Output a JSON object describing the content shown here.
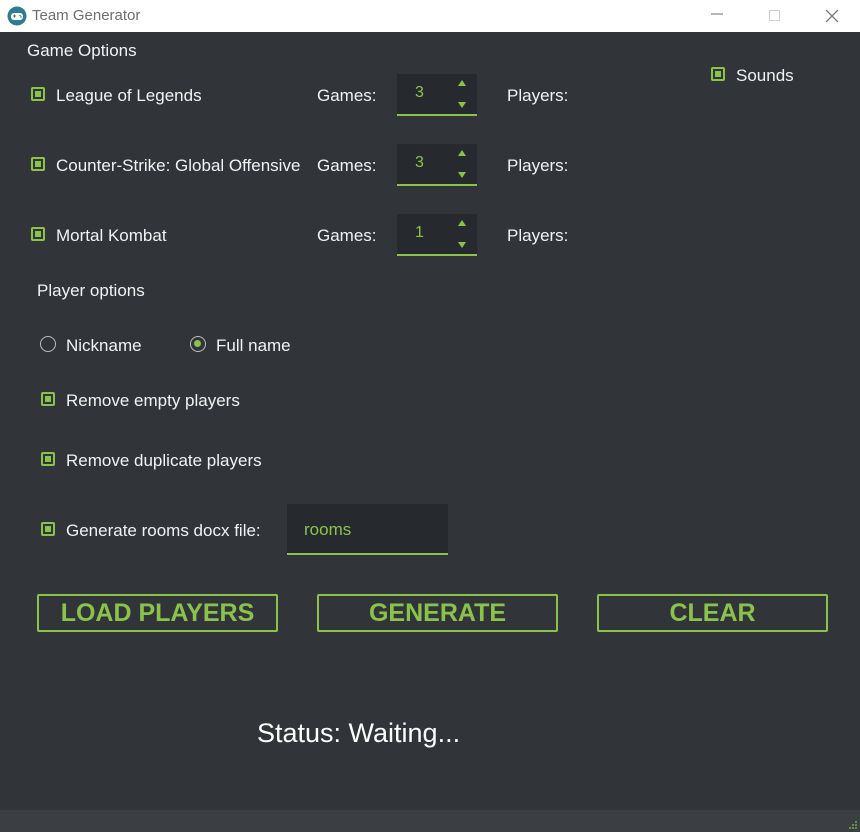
{
  "window": {
    "title": "Team Generator"
  },
  "game_options": {
    "heading": "Game Options",
    "games": [
      {
        "name": "League of Legends",
        "checked": true,
        "games_label": "Games:",
        "games_value": "3",
        "players_label": "Players:"
      },
      {
        "name": "Counter-Strike: Global Offensive",
        "checked": true,
        "games_label": "Games:",
        "games_value": "3",
        "players_label": "Players:"
      },
      {
        "name": "Mortal Kombat",
        "checked": true,
        "games_label": "Games:",
        "games_value": "1",
        "players_label": "Players:"
      }
    ],
    "sounds": {
      "label": "Sounds",
      "checked": true
    }
  },
  "player_options": {
    "heading": "Player options",
    "radio_nickname": "Nickname",
    "radio_fullname": "Full name",
    "selected": "Full name",
    "remove_empty": "Remove empty players",
    "remove_duplicate": "Remove duplicate players",
    "generate_rooms": "Generate rooms docx file:",
    "rooms_value": "rooms"
  },
  "buttons": {
    "load": "LOAD PLAYERS",
    "generate": "GENERATE",
    "clear": "CLEAR"
  },
  "status": "Status: Waiting...",
  "colors": {
    "accent": "#8bc34a",
    "background": "#31353a",
    "field": "#26292d"
  }
}
